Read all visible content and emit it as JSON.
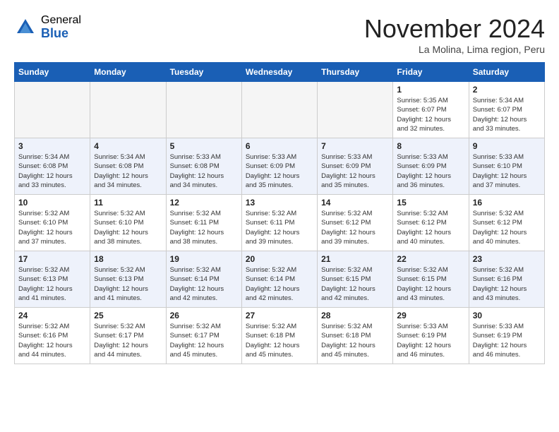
{
  "logo": {
    "general": "General",
    "blue": "Blue"
  },
  "title": "November 2024",
  "location": "La Molina, Lima region, Peru",
  "headers": [
    "Sunday",
    "Monday",
    "Tuesday",
    "Wednesday",
    "Thursday",
    "Friday",
    "Saturday"
  ],
  "weeks": [
    {
      "alt": false,
      "days": [
        {
          "num": "",
          "info": "",
          "empty": true
        },
        {
          "num": "",
          "info": "",
          "empty": true
        },
        {
          "num": "",
          "info": "",
          "empty": true
        },
        {
          "num": "",
          "info": "",
          "empty": true
        },
        {
          "num": "",
          "info": "",
          "empty": true
        },
        {
          "num": "1",
          "info": "Sunrise: 5:35 AM\nSunset: 6:07 PM\nDaylight: 12 hours\nand 32 minutes."
        },
        {
          "num": "2",
          "info": "Sunrise: 5:34 AM\nSunset: 6:07 PM\nDaylight: 12 hours\nand 33 minutes."
        }
      ]
    },
    {
      "alt": true,
      "days": [
        {
          "num": "3",
          "info": "Sunrise: 5:34 AM\nSunset: 6:08 PM\nDaylight: 12 hours\nand 33 minutes."
        },
        {
          "num": "4",
          "info": "Sunrise: 5:34 AM\nSunset: 6:08 PM\nDaylight: 12 hours\nand 34 minutes."
        },
        {
          "num": "5",
          "info": "Sunrise: 5:33 AM\nSunset: 6:08 PM\nDaylight: 12 hours\nand 34 minutes."
        },
        {
          "num": "6",
          "info": "Sunrise: 5:33 AM\nSunset: 6:09 PM\nDaylight: 12 hours\nand 35 minutes."
        },
        {
          "num": "7",
          "info": "Sunrise: 5:33 AM\nSunset: 6:09 PM\nDaylight: 12 hours\nand 35 minutes."
        },
        {
          "num": "8",
          "info": "Sunrise: 5:33 AM\nSunset: 6:09 PM\nDaylight: 12 hours\nand 36 minutes."
        },
        {
          "num": "9",
          "info": "Sunrise: 5:33 AM\nSunset: 6:10 PM\nDaylight: 12 hours\nand 37 minutes."
        }
      ]
    },
    {
      "alt": false,
      "days": [
        {
          "num": "10",
          "info": "Sunrise: 5:32 AM\nSunset: 6:10 PM\nDaylight: 12 hours\nand 37 minutes."
        },
        {
          "num": "11",
          "info": "Sunrise: 5:32 AM\nSunset: 6:10 PM\nDaylight: 12 hours\nand 38 minutes."
        },
        {
          "num": "12",
          "info": "Sunrise: 5:32 AM\nSunset: 6:11 PM\nDaylight: 12 hours\nand 38 minutes."
        },
        {
          "num": "13",
          "info": "Sunrise: 5:32 AM\nSunset: 6:11 PM\nDaylight: 12 hours\nand 39 minutes."
        },
        {
          "num": "14",
          "info": "Sunrise: 5:32 AM\nSunset: 6:12 PM\nDaylight: 12 hours\nand 39 minutes."
        },
        {
          "num": "15",
          "info": "Sunrise: 5:32 AM\nSunset: 6:12 PM\nDaylight: 12 hours\nand 40 minutes."
        },
        {
          "num": "16",
          "info": "Sunrise: 5:32 AM\nSunset: 6:12 PM\nDaylight: 12 hours\nand 40 minutes."
        }
      ]
    },
    {
      "alt": true,
      "days": [
        {
          "num": "17",
          "info": "Sunrise: 5:32 AM\nSunset: 6:13 PM\nDaylight: 12 hours\nand 41 minutes."
        },
        {
          "num": "18",
          "info": "Sunrise: 5:32 AM\nSunset: 6:13 PM\nDaylight: 12 hours\nand 41 minutes."
        },
        {
          "num": "19",
          "info": "Sunrise: 5:32 AM\nSunset: 6:14 PM\nDaylight: 12 hours\nand 42 minutes."
        },
        {
          "num": "20",
          "info": "Sunrise: 5:32 AM\nSunset: 6:14 PM\nDaylight: 12 hours\nand 42 minutes."
        },
        {
          "num": "21",
          "info": "Sunrise: 5:32 AM\nSunset: 6:15 PM\nDaylight: 12 hours\nand 42 minutes."
        },
        {
          "num": "22",
          "info": "Sunrise: 5:32 AM\nSunset: 6:15 PM\nDaylight: 12 hours\nand 43 minutes."
        },
        {
          "num": "23",
          "info": "Sunrise: 5:32 AM\nSunset: 6:16 PM\nDaylight: 12 hours\nand 43 minutes."
        }
      ]
    },
    {
      "alt": false,
      "days": [
        {
          "num": "24",
          "info": "Sunrise: 5:32 AM\nSunset: 6:16 PM\nDaylight: 12 hours\nand 44 minutes."
        },
        {
          "num": "25",
          "info": "Sunrise: 5:32 AM\nSunset: 6:17 PM\nDaylight: 12 hours\nand 44 minutes."
        },
        {
          "num": "26",
          "info": "Sunrise: 5:32 AM\nSunset: 6:17 PM\nDaylight: 12 hours\nand 45 minutes."
        },
        {
          "num": "27",
          "info": "Sunrise: 5:32 AM\nSunset: 6:18 PM\nDaylight: 12 hours\nand 45 minutes."
        },
        {
          "num": "28",
          "info": "Sunrise: 5:32 AM\nSunset: 6:18 PM\nDaylight: 12 hours\nand 45 minutes."
        },
        {
          "num": "29",
          "info": "Sunrise: 5:33 AM\nSunset: 6:19 PM\nDaylight: 12 hours\nand 46 minutes."
        },
        {
          "num": "30",
          "info": "Sunrise: 5:33 AM\nSunset: 6:19 PM\nDaylight: 12 hours\nand 46 minutes."
        }
      ]
    }
  ]
}
